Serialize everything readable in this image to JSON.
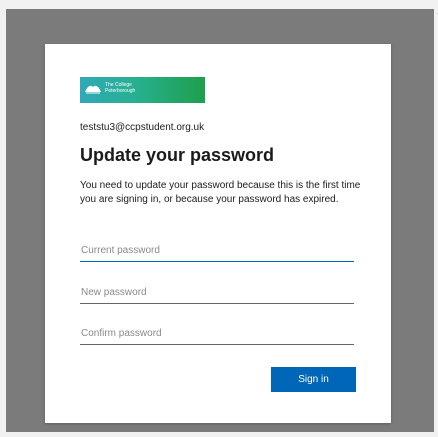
{
  "logo": {
    "line1": "The College",
    "line2": "Peterborough"
  },
  "account": {
    "email": "teststu3@ccpstudent.org.uk"
  },
  "header": {
    "title": "Update your password"
  },
  "message": {
    "text": "You need to update your password because this is the first time you are signing in, or because your password has expired."
  },
  "form": {
    "current_password_placeholder": "Current password",
    "new_password_placeholder": "New password",
    "confirm_password_placeholder": "Confirm password",
    "submit_label": "Sign in"
  },
  "colors": {
    "accent": "#0067b8",
    "frame": "#7b7b7b"
  }
}
